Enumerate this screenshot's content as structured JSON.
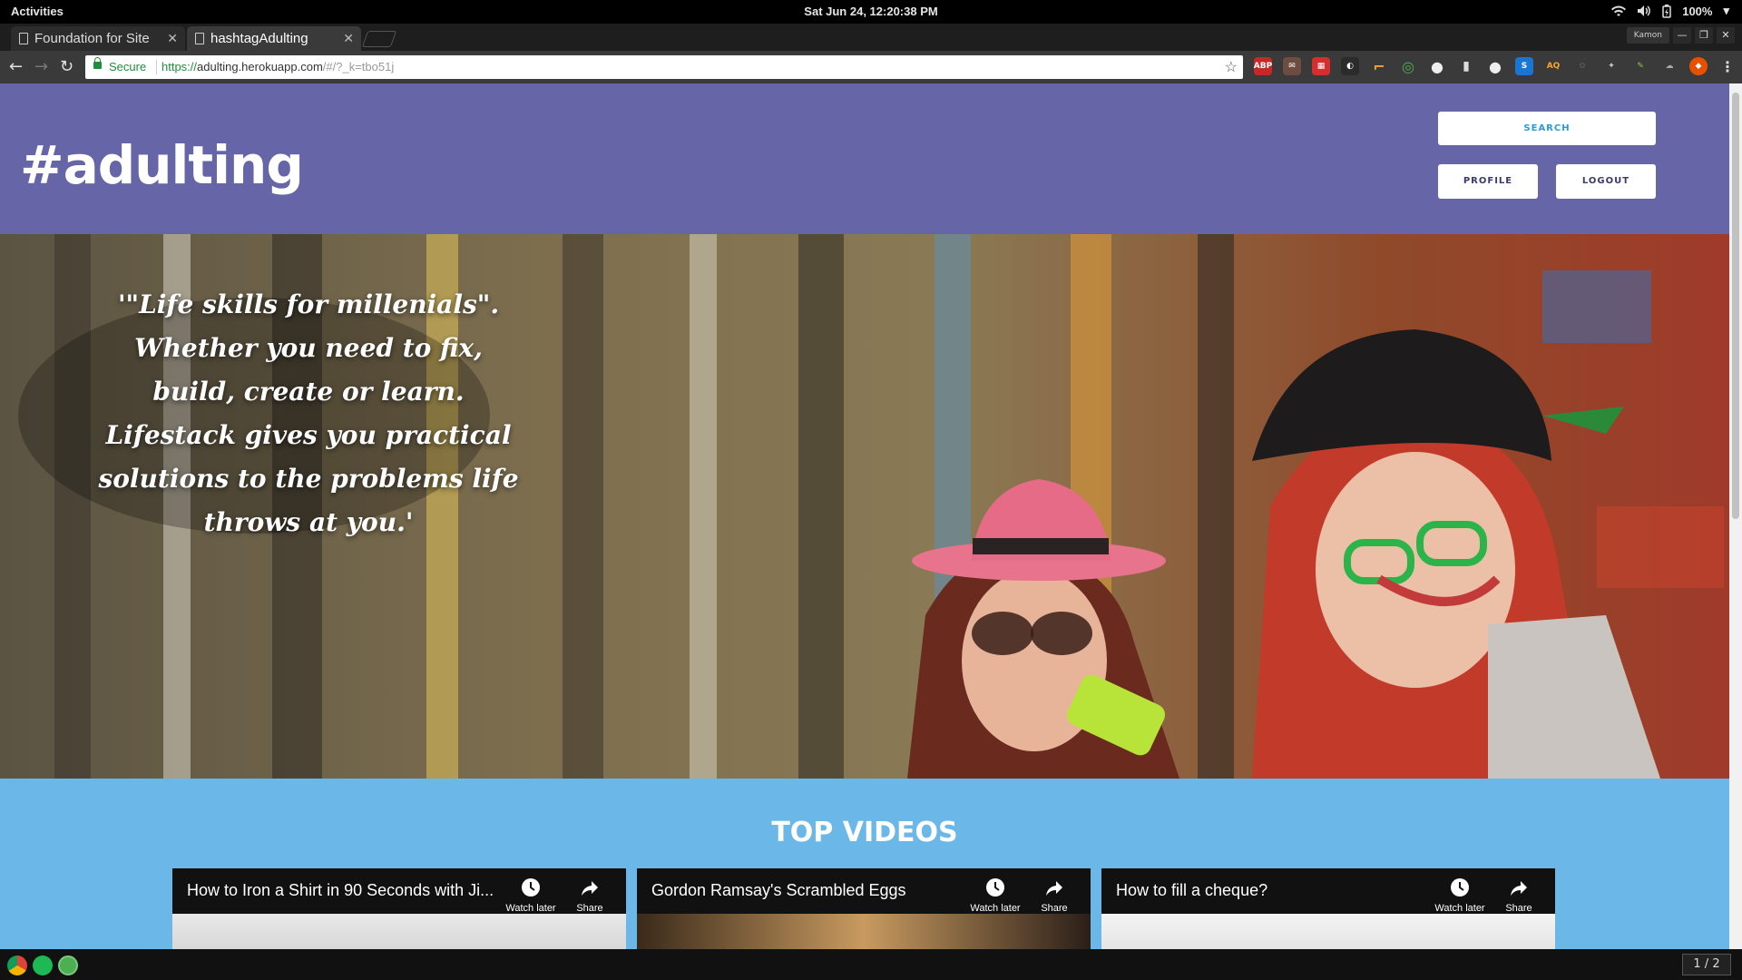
{
  "system": {
    "activities": "Activities",
    "clock": "Sat Jun 24, 12:20:38 PM",
    "battery": "100%"
  },
  "browser": {
    "tabs": [
      {
        "title": "Foundation for Site",
        "active": false
      },
      {
        "title": "hashtagAdulting",
        "active": true
      }
    ],
    "profile_name": "Kamon",
    "secure_label": "Secure",
    "url_scheme": "https://",
    "url_host": "adulting.herokuapp.com",
    "url_path": "/#/?_k=tbo51j"
  },
  "site": {
    "logo": "#adulting",
    "buttons": {
      "search": "SEARCH",
      "profile": "PROFILE",
      "logout": "LOGOUT"
    },
    "hero_quote": "'\"Life skills for millenials\". Whether you need to fix, build, create or learn. Lifestack gives you practical solutions to the problems life throws at you.'",
    "section_title": "TOP VIDEOS",
    "videos": [
      {
        "title": "How to Iron a Shirt in 90 Seconds with Ji...",
        "watch_later": "Watch later",
        "share": "Share"
      },
      {
        "title": "Gordon Ramsay's Scrambled Eggs",
        "watch_later": "Watch later",
        "share": "Share"
      },
      {
        "title": "How to fill a cheque?",
        "watch_later": "Watch later",
        "share": "Share"
      }
    ]
  },
  "dock": {
    "pager": "1 / 2"
  },
  "colors": {
    "header_bg": "#6565a8",
    "videos_bg": "#6bb8e8",
    "secure_green": "#1e8e3e"
  }
}
